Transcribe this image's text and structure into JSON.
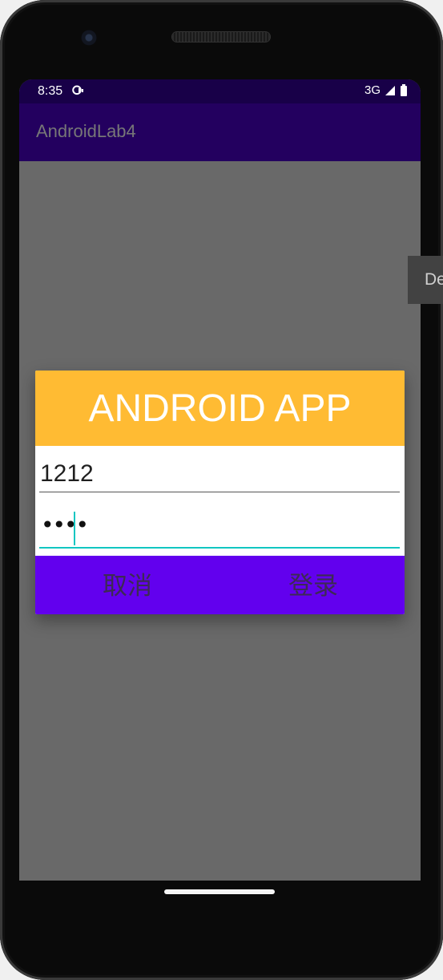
{
  "status_bar": {
    "time": "8:35",
    "network": "3G",
    "icons": [
      "notification-icon",
      "signal-icon",
      "battery-icon"
    ]
  },
  "app_bar": {
    "title": "AndroidLab4"
  },
  "side_tab": {
    "label": "De"
  },
  "dialog": {
    "title": "ANDROID APP",
    "username_value": "1212",
    "password_value": "••••",
    "cancel_label": "取消",
    "login_label": "登录"
  },
  "colors": {
    "dialog_header": "#ffbb33",
    "button_bar": "#6200ee",
    "input_accent": "#11c6c1",
    "app_bar": "#23005f",
    "status_bar": "#180048",
    "dim_background": "#696969"
  }
}
